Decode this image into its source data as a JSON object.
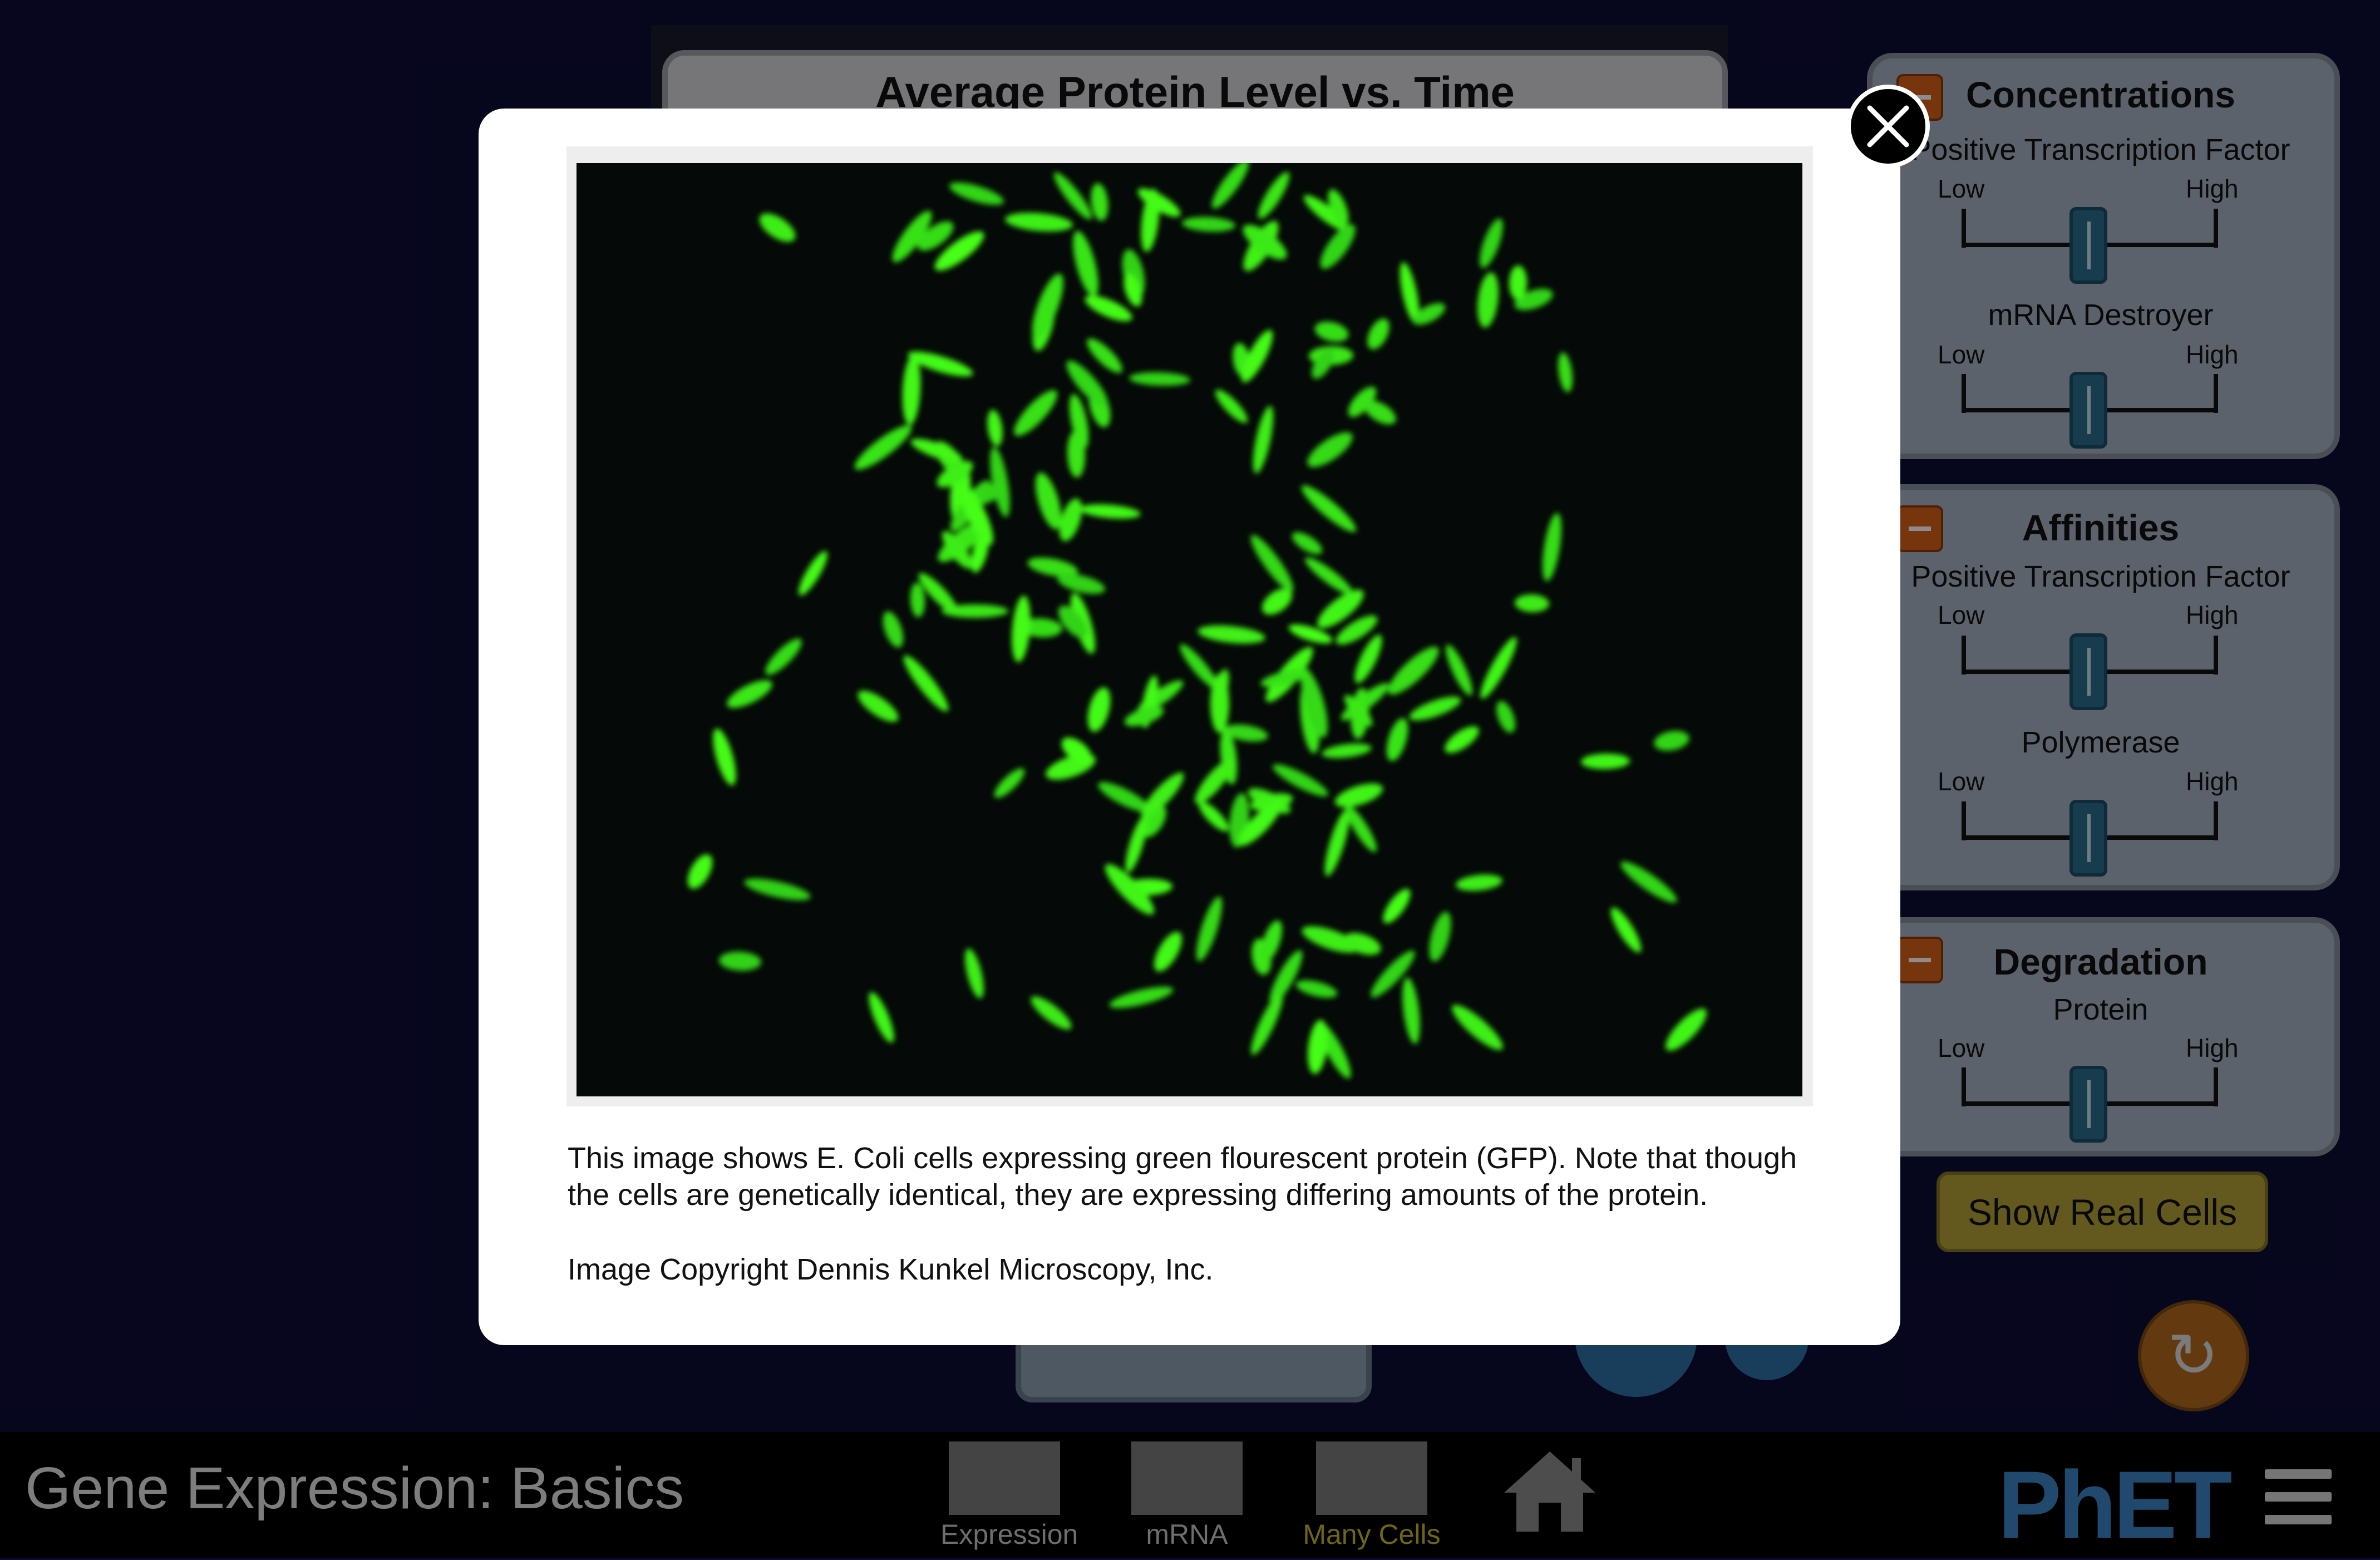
{
  "app": {
    "title": "Gene Expression: Basics"
  },
  "chart": {
    "title": "Average Protein Level vs. Time"
  },
  "panels": {
    "concentrations": {
      "title": "Concentrations",
      "sliders": [
        {
          "label": "Positive Transcription Factor",
          "low": "Low",
          "high": "High"
        },
        {
          "label": "mRNA Destroyer",
          "low": "Low",
          "high": "High"
        }
      ]
    },
    "affinities": {
      "title": "Affinities",
      "sliders": [
        {
          "label": "Positive Transcription Factor",
          "low": "Low",
          "high": "High"
        },
        {
          "label": "Polymerase",
          "low": "Low",
          "high": "High"
        }
      ]
    },
    "degradation": {
      "title": "Degradation",
      "sliders": [
        {
          "label": "Protein",
          "low": "Low",
          "high": "High"
        }
      ]
    }
  },
  "buttons": {
    "show_real_cells": "Show Real Cells"
  },
  "navbar": {
    "screens": [
      {
        "label": "Expression",
        "active": false
      },
      {
        "label": "mRNA",
        "active": false
      },
      {
        "label": "Many Cells",
        "active": true
      }
    ],
    "logo": "PhET"
  },
  "dialog": {
    "caption": "This image shows E. Coli cells expressing green flourescent protein (GFP). Note that though the cells are genetically identical, they are expressing differing amounts of the protein.",
    "copyright": "Image Copyright Dennis Kunkel Microscopy, Inc."
  },
  "colors": {
    "background": "#0c0b36",
    "cell_green": "#39e616",
    "accent_orange": "#d9621a",
    "button_yellow": "#b5a33a"
  },
  "icons": {
    "close": "close-icon",
    "home": "home-icon",
    "menu": "hamburger-menu-icon",
    "reset": "reset-all-icon"
  }
}
